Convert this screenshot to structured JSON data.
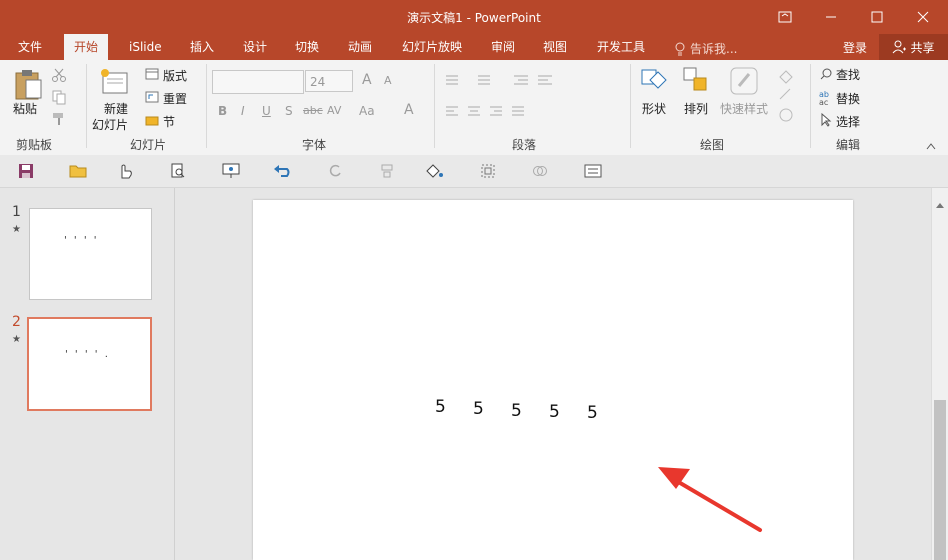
{
  "window": {
    "title": "演示文稿1 - PowerPoint"
  },
  "menu": {
    "tabs": [
      "文件",
      "开始",
      "iSlide",
      "插入",
      "设计",
      "切换",
      "动画",
      "幻灯片放映",
      "审阅",
      "视图",
      "开发工具"
    ],
    "active": "开始",
    "tell_me": "告诉我...",
    "login": "登录",
    "share": "共享"
  },
  "ribbon": {
    "clipboard": {
      "label": "剪贴板",
      "paste": "粘贴"
    },
    "slides": {
      "label": "幻灯片",
      "new_slide_line1": "新建",
      "new_slide_line2": "幻灯片",
      "layout": "版式",
      "reset": "重置",
      "section": "节"
    },
    "font": {
      "label": "字体",
      "font_size": "24",
      "bold": "B",
      "italic": "I",
      "underline": "U",
      "shadow": "S",
      "strike": "abc",
      "spacing": "AV",
      "case": "Aa",
      "color": "A",
      "grow": "A",
      "shrink": "A"
    },
    "paragraph": {
      "label": "段落"
    },
    "drawing": {
      "label": "绘图",
      "shapes": "形状",
      "arrange": "排列",
      "quick_styles": "快速样式"
    },
    "editing": {
      "label": "编辑",
      "find": "查找",
      "replace": "替换",
      "select": "选择"
    }
  },
  "thumbnails": [
    {
      "number": "1",
      "star": "★",
      "content": "' ' ' '",
      "selected": false
    },
    {
      "number": "2",
      "star": "★",
      "content": "' ' ' ' .",
      "selected": true
    }
  ],
  "slide": {
    "digits": [
      "5",
      "5",
      "5",
      "5",
      "5"
    ]
  },
  "colors": {
    "accent": "#b7472a",
    "arrow": "#e8372d"
  }
}
